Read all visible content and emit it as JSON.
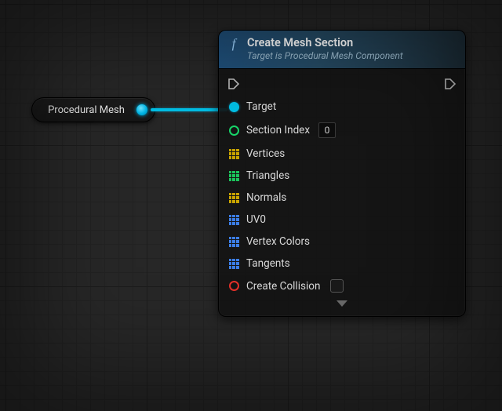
{
  "var_node": {
    "label": "Procedural Mesh"
  },
  "node": {
    "title": "Create Mesh Section",
    "subtitle": "Target is Procedural Mesh Component",
    "pins": {
      "target": "Target",
      "section_index": "Section Index",
      "section_index_value": "0",
      "vertices": "Vertices",
      "triangles": "Triangles",
      "normals": "Normals",
      "uv0": "UV0",
      "vertex_colors": "Vertex Colors",
      "tangents": "Tangents",
      "create_collision": "Create Collision"
    }
  }
}
